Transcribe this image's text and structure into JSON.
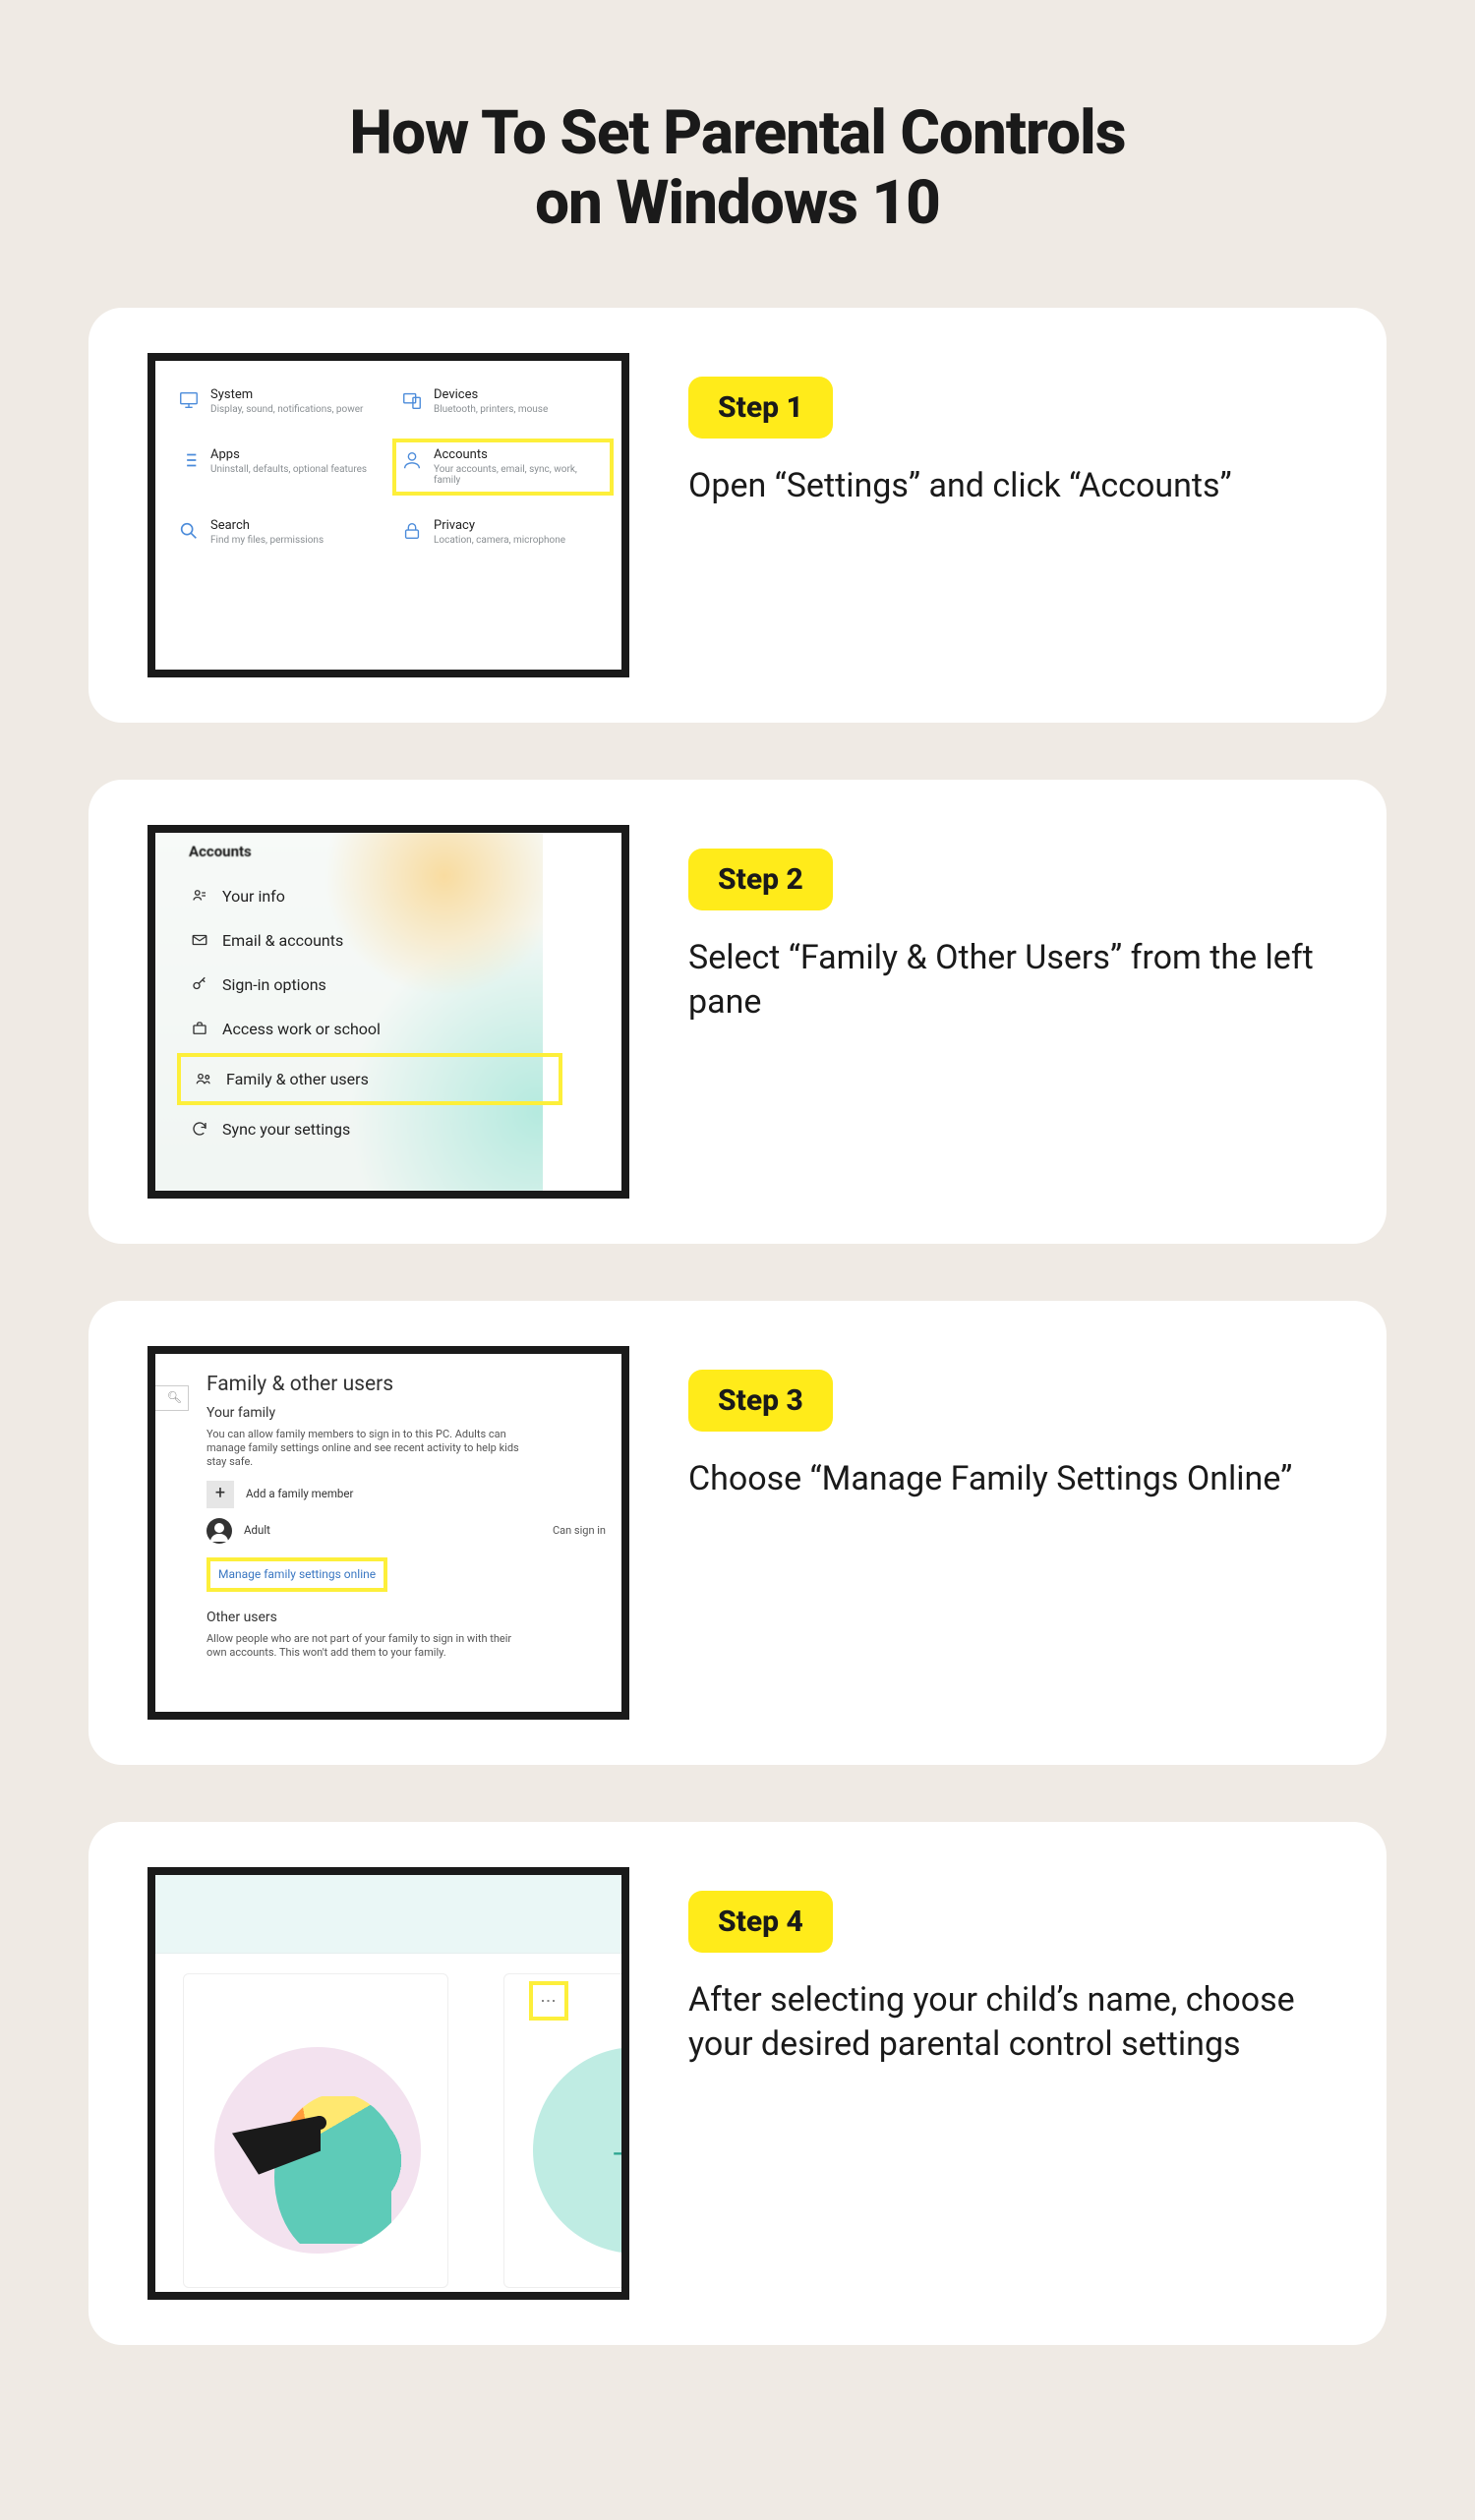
{
  "title_line1": "How To Set Parental Controls",
  "title_line2": "on Windows 10",
  "steps": [
    {
      "badge": "Step 1",
      "text": "Open “Settings” and click “Accounts”"
    },
    {
      "badge": "Step 2",
      "text": "Select “Family & Other Users” from the left pane"
    },
    {
      "badge": "Step 3",
      "text": "Choose “Manage Family Settings Online”"
    },
    {
      "badge": "Step 4",
      "text": "After selecting your child’s name, choose your desired parental control settings"
    }
  ],
  "step1_tiles": {
    "system": {
      "title": "System",
      "sub": "Display, sound, notifications, power"
    },
    "devices": {
      "title": "Devices",
      "sub": "Bluetooth, printers, mouse"
    },
    "apps": {
      "title": "Apps",
      "sub": "Uninstall, defaults, optional features"
    },
    "accounts": {
      "title": "Accounts",
      "sub": "Your accounts, email, sync, work, family"
    },
    "search": {
      "title": "Search",
      "sub": "Find my files, permissions"
    },
    "privacy": {
      "title": "Privacy",
      "sub": "Location, camera, microphone"
    }
  },
  "step2_sidebar": {
    "header": "Accounts",
    "items": [
      "Your info",
      "Email & accounts",
      "Sign-in options",
      "Access work or school",
      "Family & other users",
      "Sync your settings"
    ]
  },
  "step3": {
    "heading": "Family & other users",
    "your_family_h": "Your family",
    "your_family_p": "You can allow family members to sign in to this PC. Adults can manage family settings online and see recent activity to help kids stay safe.",
    "add_member": "Add a family member",
    "adult_label": "Adult",
    "can_sign_in": "Can sign in",
    "manage_link": "Manage family settings online",
    "other_users_h": "Other users",
    "other_users_p": "Allow people who are not part of your family to sign in with their own accounts. This won't add them to your family."
  },
  "step4": {
    "kebab": "⋮"
  }
}
